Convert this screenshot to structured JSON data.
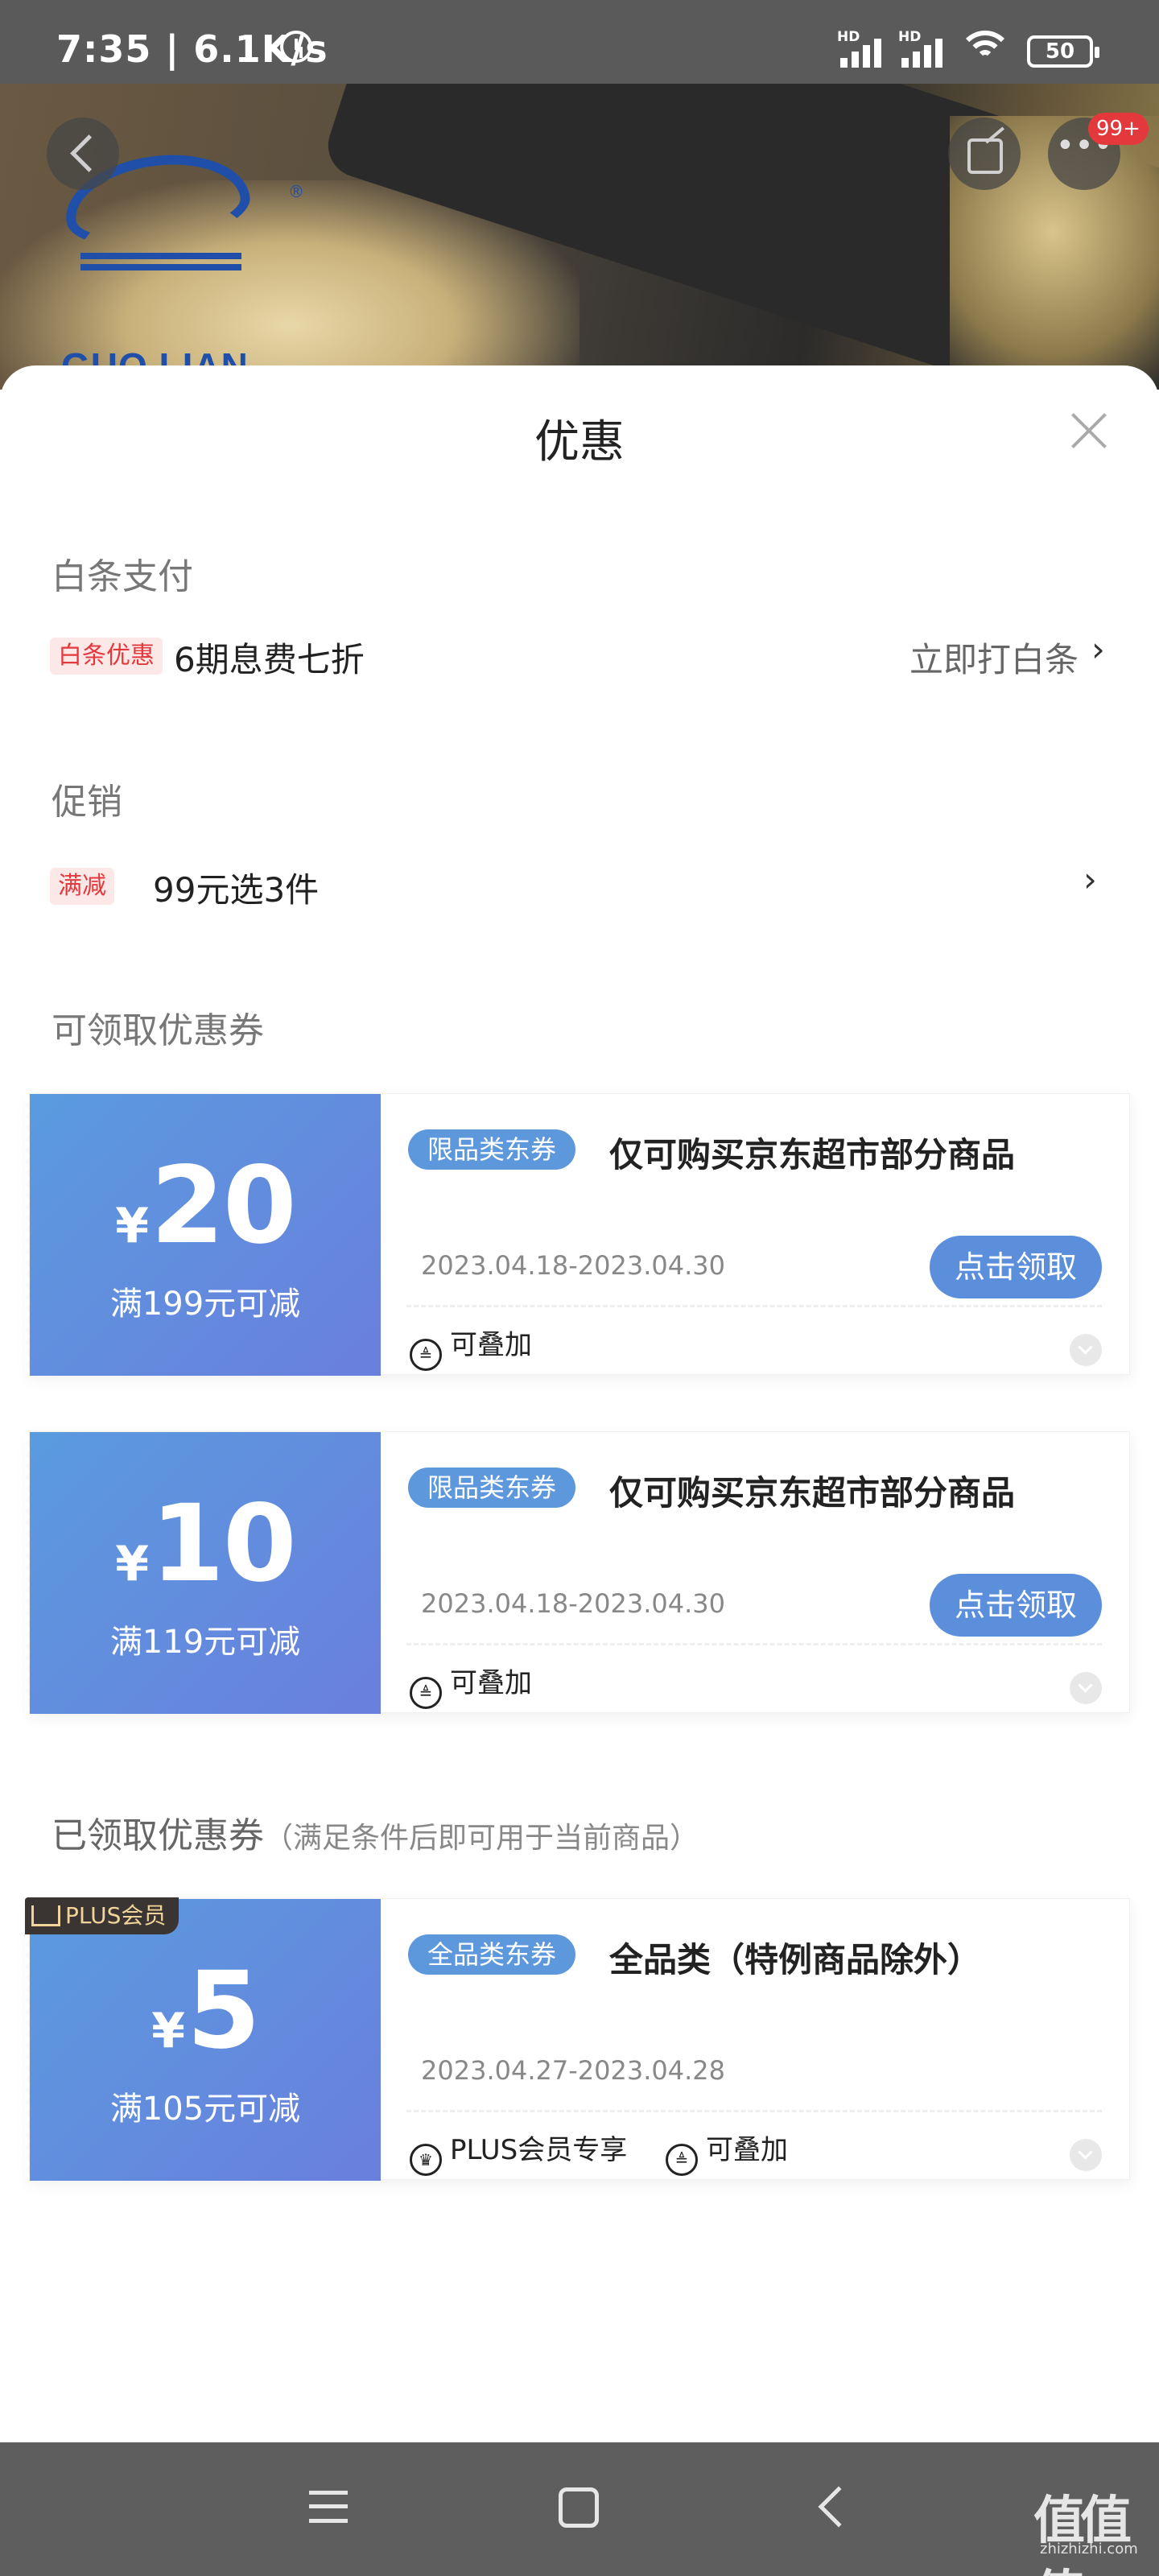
{
  "status_bar": {
    "time": "7:35",
    "speed": "6.1K/s",
    "battery": "50",
    "sig1": "HD",
    "sig2": "HD"
  },
  "hero": {
    "brand_text": "GUO LIAN",
    "reg_mark": "®",
    "notification_badge": "99+"
  },
  "sheet": {
    "title": "优惠"
  },
  "baitiao": {
    "section_title": "白条支付",
    "tag": "白条优惠",
    "text": "6期息费七折",
    "action": "立即打白条"
  },
  "promotion": {
    "section_title": "促销",
    "tag": "满减",
    "text": "99元选3件"
  },
  "available": {
    "section_title": "可领取优惠券",
    "coupons": [
      {
        "currency": "¥",
        "amount": "20",
        "condition": "满199元可减",
        "tag": "限品类东券",
        "name": "仅可购买京东超市部分商品",
        "dates": "2023.04.18-2023.04.30",
        "claim": "点击领取",
        "feature": "可叠加"
      },
      {
        "currency": "¥",
        "amount": "10",
        "condition": "满119元可减",
        "tag": "限品类东券",
        "name": "仅可购买京东超市部分商品",
        "dates": "2023.04.18-2023.04.30",
        "claim": "点击领取",
        "feature": "可叠加"
      }
    ]
  },
  "claimed": {
    "section_title": "已领取优惠券",
    "section_note": "（满足条件后即可用于当前商品）",
    "coupon": {
      "badge": "PLUS会员",
      "currency": "¥",
      "amount": "5",
      "condition": "满105元可减",
      "tag": "全品类东券",
      "name": "全品类（特例商品除外）",
      "dates": "2023.04.27-2023.04.28",
      "feature1": "PLUS会员专享",
      "feature2": "可叠加"
    }
  },
  "watermark": {
    "big": "值值值",
    "small": "zhizhizhi.com"
  },
  "colors": {
    "coupon_gradient_start": "#5a9bdf",
    "coupon_gradient_end": "#6a7fdd",
    "claim_button": "#5b8fdc",
    "red_tag": "#e4393c"
  }
}
